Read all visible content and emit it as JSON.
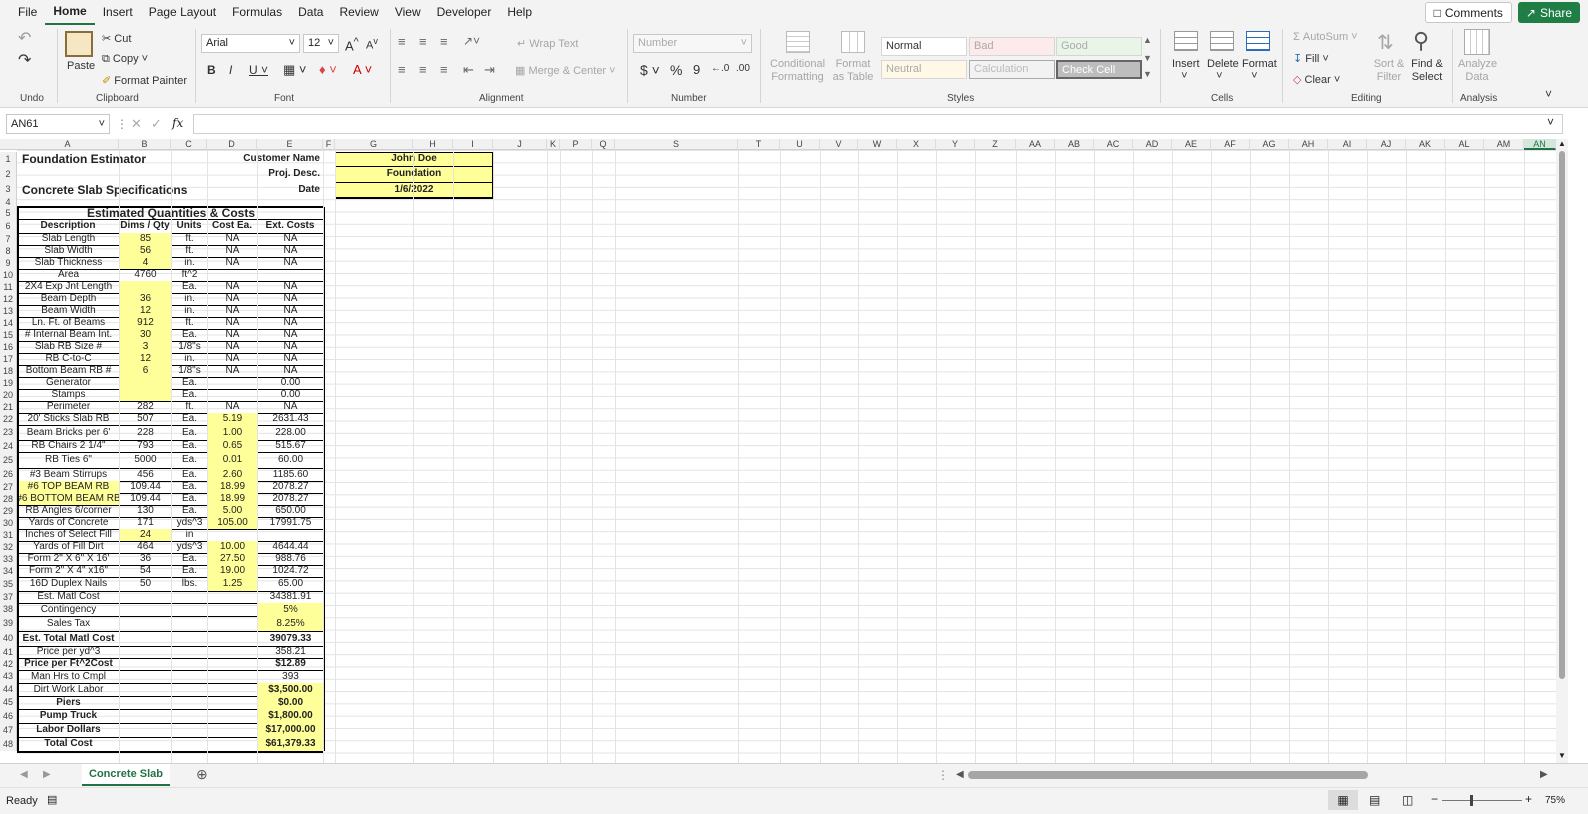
{
  "menu": {
    "file": "File",
    "home": "Home",
    "insert": "Insert",
    "page_layout": "Page Layout",
    "formulas": "Formulas",
    "data": "Data",
    "review": "Review",
    "view": "View",
    "developer": "Developer",
    "help": "Help",
    "comments": "Comments",
    "share": "Share"
  },
  "ribbon": {
    "undo_group": "Undo",
    "clipboard_group": "Clipboard",
    "font_group": "Font",
    "alignment_group": "Alignment",
    "number_group": "Number",
    "styles_group": "Styles",
    "cells_group": "Cells",
    "editing_group": "Editing",
    "analysis_group": "Analysis",
    "paste": "Paste",
    "cut": "Cut",
    "copy": "Copy",
    "format_painter": "Format Painter",
    "font_name": "Arial",
    "font_size": "12",
    "wrap_text": "Wrap Text",
    "merge_center": "Merge & Center",
    "number_format": "Number",
    "conditional_formatting": "Conditional Formatting",
    "format_as_table": "Format as Table",
    "style_normal": "Normal",
    "style_bad": "Bad",
    "style_good": "Good",
    "style_neutral": "Neutral",
    "style_calculation": "Calculation",
    "style_check_cell": "Check Cell",
    "insert": "Insert",
    "delete": "Delete",
    "format": "Format",
    "autosum": "AutoSum",
    "fill": "Fill",
    "clear": "Clear",
    "sort_filter": "Sort & Filter",
    "find_select": "Find & Select",
    "analyze_data": "Analyze Data"
  },
  "formula_bar": {
    "name_box": "AN61",
    "fx": "fx",
    "value": ""
  },
  "columns": [
    "A",
    "B",
    "C",
    "D",
    "E",
    "F",
    "G",
    "H",
    "I",
    "J",
    "K",
    "P",
    "Q",
    "S",
    "T",
    "U",
    "V",
    "W",
    "X",
    "Y",
    "Z",
    "AA",
    "AB",
    "AC",
    "AD",
    "AE",
    "AF",
    "AG",
    "AH",
    "AI",
    "AJ",
    "AK",
    "AL",
    "AM",
    "AN"
  ],
  "rows": [
    "1",
    "2",
    "3",
    "4",
    "5",
    "6",
    "7",
    "8",
    "9",
    "10",
    "11",
    "12",
    "13",
    "14",
    "15",
    "16",
    "17",
    "18",
    "19",
    "20",
    "21",
    "22",
    "23",
    "24",
    "25",
    "26",
    "27",
    "28",
    "29",
    "30",
    "31",
    "32",
    "33",
    "34",
    "35",
    "37",
    "38",
    "39",
    "40",
    "41",
    "42",
    "43",
    "44",
    "45",
    "46",
    "47",
    "48"
  ],
  "header": {
    "title": "Foundation Estimator",
    "subtitle": "Concrete Slab Specifications",
    "customer_label": "Customer Name",
    "customer_value": "John Doe",
    "proj_label": "Proj. Desc.",
    "proj_value": "Foundation",
    "date_label": "Date",
    "date_value": "1/6/2022"
  },
  "table": {
    "title": "Estimated Quantities & Costs",
    "col_headers": [
      "Description",
      "Dims / Qty",
      "Units",
      "Cost Ea.",
      "Ext. Costs"
    ],
    "rows": [
      [
        "Slab Length",
        "85",
        "ft.",
        "NA",
        "NA"
      ],
      [
        "Slab Width",
        "56",
        "ft.",
        "NA",
        "NA"
      ],
      [
        "Slab Thickness",
        "4",
        "in.",
        "NA",
        "NA"
      ],
      [
        "Area",
        "4760",
        "ft^2",
        "",
        ""
      ],
      [
        "2X4 Exp Jnt Length",
        "",
        "Ea.",
        "NA",
        "NA"
      ],
      [
        "Beam Depth",
        "36",
        "in.",
        "NA",
        "NA"
      ],
      [
        "Beam Width",
        "12",
        "in.",
        "NA",
        "NA"
      ],
      [
        "Ln. Ft. of Beams",
        "912",
        "ft.",
        "NA",
        "NA"
      ],
      [
        "# Internal Beam Int.",
        "30",
        "Ea.",
        "NA",
        "NA"
      ],
      [
        "Slab RB Size #",
        "3",
        "1/8\"s",
        "NA",
        "NA"
      ],
      [
        "RB C-to-C",
        "12",
        "in.",
        "NA",
        "NA"
      ],
      [
        "Bottom Beam RB #",
        "6",
        "1/8\"s",
        "NA",
        "NA"
      ],
      [
        "Generator",
        "",
        "Ea.",
        "",
        "0.00"
      ],
      [
        "Stamps",
        "",
        "Ea.",
        "",
        "0.00"
      ],
      [
        "Perimeter",
        "282",
        "ft.",
        "NA",
        "NA"
      ],
      [
        "20' Sticks Slab RB",
        "507",
        "Ea.",
        "5.19",
        "2631.43"
      ],
      [
        "Beam Bricks per 6'",
        "228",
        "Ea.",
        "1.00",
        "228.00"
      ],
      [
        "RB Chairs 2 1/4\"",
        "793",
        "Ea.",
        "0.65",
        "515.67"
      ],
      [
        "RB Ties 6\"",
        "5000",
        "Ea.",
        "0.01",
        "60.00"
      ],
      [
        "#3 Beam Stirrups",
        "456",
        "Ea.",
        "2.60",
        "1185.60"
      ],
      [
        "#6 TOP BEAM RB",
        "109.44",
        "Ea.",
        "18.99",
        "2078.27"
      ],
      [
        "#6 BOTTOM BEAM RB",
        "109.44",
        "Ea.",
        "18.99",
        "2078.27"
      ],
      [
        "RB Angles 6/corner",
        "130",
        "Ea.",
        "5.00",
        "650.00"
      ],
      [
        "Yards of Concrete",
        "171",
        "yds^3",
        "105.00",
        "17991.75"
      ],
      [
        "Inches of Select Fill",
        "24",
        "in",
        "",
        ""
      ],
      [
        "Yards of Fill Dirt",
        "464",
        "yds^3",
        "10.00",
        "4644.44"
      ],
      [
        "Form  2\" X 6\" X 16'",
        "36",
        "Ea.",
        "27.50",
        "988.76"
      ],
      [
        "Form  2\" X 4\" x16\"",
        "54",
        "Ea.",
        "19.00",
        "1024.72"
      ],
      [
        "16D Duplex Nails",
        "50",
        "lbs.",
        "1.25",
        "65.00"
      ],
      [
        "Est. Matl Cost",
        "",
        "",
        "",
        "34381.91"
      ],
      [
        "Contingency",
        "",
        "",
        "",
        "5%"
      ],
      [
        "Sales Tax",
        "",
        "",
        "",
        "8.25%"
      ],
      [
        "Est. Total Matl Cost",
        "",
        "",
        "",
        "39079.33"
      ],
      [
        "Price per yd^3",
        "",
        "",
        "",
        "358.21"
      ],
      [
        "Price per Ft^2Cost",
        "",
        "",
        "",
        "$12.89"
      ],
      [
        "Man Hrs to Cmpl",
        "",
        "",
        "",
        "393"
      ],
      [
        "Dirt Work Labor",
        "",
        "",
        "",
        "$3,500.00"
      ],
      [
        "Piers",
        "",
        "",
        "",
        "$0.00"
      ],
      [
        "Pump Truck",
        "",
        "",
        "",
        "$1,800.00"
      ],
      [
        "Labor Dollars",
        "",
        "",
        "",
        "$17,000.00"
      ],
      [
        "Total Cost",
        "",
        "",
        "",
        "$61,379.33"
      ]
    ]
  },
  "sheet_tab": "Concrete Slab",
  "status": {
    "ready": "Ready",
    "zoom": "75%"
  },
  "colors": {
    "accent": "#217346",
    "highlight": "#ffff99"
  }
}
